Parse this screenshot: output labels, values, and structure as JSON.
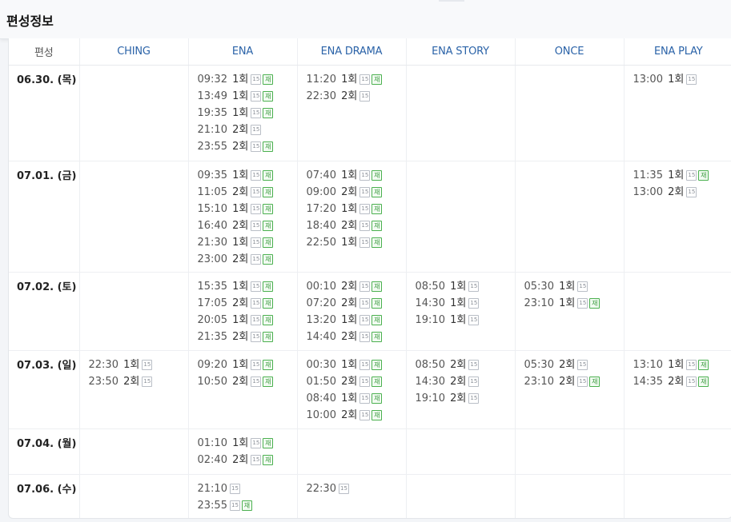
{
  "header": {
    "title": "편성정보"
  },
  "table": {
    "columns": [
      "편성",
      "CHING",
      "ENA",
      "ENA DRAMA",
      "ENA STORY",
      "ONCE",
      "ENA PLAY"
    ],
    "rows": [
      {
        "date": "06.30. (목)",
        "height": 120,
        "cells": [
          [],
          [
            {
              "time": "09:32",
              "ep": "1회",
              "rating": "15",
              "rerun": "재"
            },
            {
              "time": "13:49",
              "ep": "1회",
              "rating": "15",
              "rerun": "재"
            },
            {
              "time": "19:35",
              "ep": "1회",
              "rating": "15",
              "rerun": "재"
            },
            {
              "time": "21:10",
              "ep": "2회",
              "rating": "15",
              "rerun": ""
            },
            {
              "time": "23:55",
              "ep": "2회",
              "rating": "15",
              "rerun": "재"
            }
          ],
          [
            {
              "time": "11:20",
              "ep": "1회",
              "rating": "15",
              "rerun": "재"
            },
            {
              "time": "22:30",
              "ep": "2회",
              "rating": "15",
              "rerun": ""
            }
          ],
          [],
          [],
          [
            {
              "time": "13:00",
              "ep": "1회",
              "rating": "15",
              "rerun": ""
            }
          ]
        ]
      },
      {
        "date": "07.01. (금)",
        "height": 139,
        "cells": [
          [],
          [
            {
              "time": "09:35",
              "ep": "1회",
              "rating": "15",
              "rerun": "재"
            },
            {
              "time": "11:05",
              "ep": "2회",
              "rating": "15",
              "rerun": "재"
            },
            {
              "time": "15:10",
              "ep": "1회",
              "rating": "15",
              "rerun": "재"
            },
            {
              "time": "16:40",
              "ep": "2회",
              "rating": "15",
              "rerun": "재"
            },
            {
              "time": "21:30",
              "ep": "1회",
              "rating": "15",
              "rerun": "재"
            },
            {
              "time": "23:00",
              "ep": "2회",
              "rating": "15",
              "rerun": "재"
            }
          ],
          [
            {
              "time": "07:40",
              "ep": "1회",
              "rating": "15",
              "rerun": "재"
            },
            {
              "time": "09:00",
              "ep": "2회",
              "rating": "15",
              "rerun": "재"
            },
            {
              "time": "17:20",
              "ep": "1회",
              "rating": "15",
              "rerun": "재"
            },
            {
              "time": "18:40",
              "ep": "2회",
              "rating": "15",
              "rerun": "재"
            },
            {
              "time": "22:50",
              "ep": "1회",
              "rating": "15",
              "rerun": "재"
            }
          ],
          [],
          [],
          [
            {
              "time": "11:35",
              "ep": "1회",
              "rating": "15",
              "rerun": "재"
            },
            {
              "time": "13:00",
              "ep": "2회",
              "rating": "15",
              "rerun": ""
            }
          ]
        ]
      },
      {
        "date": "07.02. (토)",
        "height": 98,
        "cells": [
          [],
          [
            {
              "time": "15:35",
              "ep": "1회",
              "rating": "15",
              "rerun": "재"
            },
            {
              "time": "17:05",
              "ep": "2회",
              "rating": "15",
              "rerun": "재"
            },
            {
              "time": "20:05",
              "ep": "1회",
              "rating": "15",
              "rerun": "재"
            },
            {
              "time": "21:35",
              "ep": "2회",
              "rating": "15",
              "rerun": "재"
            }
          ],
          [
            {
              "time": "00:10",
              "ep": "2회",
              "rating": "15",
              "rerun": "재"
            },
            {
              "time": "07:20",
              "ep": "2회",
              "rating": "15",
              "rerun": "재"
            },
            {
              "time": "13:20",
              "ep": "1회",
              "rating": "15",
              "rerun": "재"
            },
            {
              "time": "14:40",
              "ep": "2회",
              "rating": "15",
              "rerun": "재"
            }
          ],
          [
            {
              "time": "08:50",
              "ep": "1회",
              "rating": "15",
              "rerun": ""
            },
            {
              "time": "14:30",
              "ep": "1회",
              "rating": "15",
              "rerun": ""
            },
            {
              "time": "19:10",
              "ep": "1회",
              "rating": "15",
              "rerun": ""
            }
          ],
          [
            {
              "time": "05:30",
              "ep": "1회",
              "rating": "15",
              "rerun": ""
            },
            {
              "time": "23:10",
              "ep": "1회",
              "rating": "15",
              "rerun": "재"
            }
          ],
          []
        ]
      },
      {
        "date": "07.03. (일)",
        "height": 98,
        "cells": [
          [
            {
              "time": "22:30",
              "ep": "1회",
              "rating": "15",
              "rerun": ""
            },
            {
              "time": "23:50",
              "ep": "2회",
              "rating": "15",
              "rerun": ""
            }
          ],
          [
            {
              "time": "09:20",
              "ep": "1회",
              "rating": "15",
              "rerun": "재"
            },
            {
              "time": "10:50",
              "ep": "2회",
              "rating": "15",
              "rerun": "재"
            }
          ],
          [
            {
              "time": "00:30",
              "ep": "1회",
              "rating": "15",
              "rerun": "재"
            },
            {
              "time": "01:50",
              "ep": "2회",
              "rating": "15",
              "rerun": "재"
            },
            {
              "time": "08:40",
              "ep": "1회",
              "rating": "15",
              "rerun": "재"
            },
            {
              "time": "10:00",
              "ep": "2회",
              "rating": "15",
              "rerun": "재"
            }
          ],
          [
            {
              "time": "08:50",
              "ep": "2회",
              "rating": "15",
              "rerun": ""
            },
            {
              "time": "14:30",
              "ep": "2회",
              "rating": "15",
              "rerun": ""
            },
            {
              "time": "19:10",
              "ep": "2회",
              "rating": "15",
              "rerun": ""
            }
          ],
          [
            {
              "time": "05:30",
              "ep": "2회",
              "rating": "15",
              "rerun": ""
            },
            {
              "time": "23:10",
              "ep": "2회",
              "rating": "15",
              "rerun": "재"
            }
          ],
          [
            {
              "time": "13:10",
              "ep": "1회",
              "rating": "15",
              "rerun": "재"
            },
            {
              "time": "14:35",
              "ep": "2회",
              "rating": "15",
              "rerun": "재"
            }
          ]
        ]
      },
      {
        "date": "07.04. (월)",
        "height": 57,
        "cells": [
          [],
          [
            {
              "time": "01:10",
              "ep": "1회",
              "rating": "15",
              "rerun": "재"
            },
            {
              "time": "02:40",
              "ep": "2회",
              "rating": "15",
              "rerun": "재"
            }
          ],
          [],
          [],
          [],
          []
        ]
      },
      {
        "date": "07.06. (수)",
        "height": 57,
        "cells": [
          [],
          [
            {
              "time": "21:10",
              "ep": "",
              "rating": "15",
              "rerun": ""
            },
            {
              "time": "23:55",
              "ep": "",
              "rating": "15",
              "rerun": "재"
            }
          ],
          [
            {
              "time": "22:30",
              "ep": "",
              "rating": "15",
              "rerun": ""
            }
          ],
          [],
          [],
          []
        ]
      }
    ]
  }
}
